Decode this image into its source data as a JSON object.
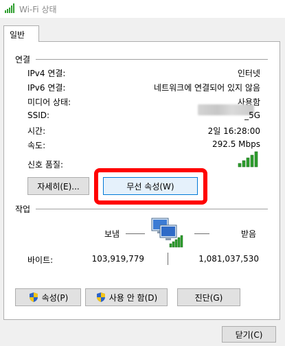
{
  "window": {
    "title": "Wi-Fi 상태"
  },
  "tabs": [
    {
      "label": "일반"
    }
  ],
  "connection": {
    "heading": "연결",
    "rows": [
      {
        "label": "IPv4 연결:",
        "value": "인터넷"
      },
      {
        "label": "IPv6 연결:",
        "value": "네트워크에 연결되어 있지 않음"
      },
      {
        "label": "미디어 상태:",
        "value": "사용함"
      },
      {
        "label": "SSID:",
        "value": "_5G"
      },
      {
        "label": "시간:",
        "value": "2일 16:28:00"
      },
      {
        "label": "속도:",
        "value": "292.5 Mbps"
      }
    ],
    "signal_label": "신호 품질:",
    "signal_bars_filled": 5,
    "signal_bars_total": 5,
    "details_button": "자세히(E)...",
    "wireless_properties_button": "무선 속성(W)"
  },
  "activity": {
    "heading": "작업",
    "sent_label": "보냄",
    "received_label": "받음",
    "bytes_label": "바이트:",
    "bytes_sent": "103,919,779",
    "bytes_received": "1,081,037,530"
  },
  "actions": {
    "properties_button": "속성(P)",
    "disable_button": "사용 안 함(D)",
    "diagnose_button": "진단(G)"
  },
  "footer": {
    "close_button": "닫기(C)"
  },
  "colors": {
    "signal_green": "#2e9e2e",
    "highlight_red": "#ff0000",
    "section_line": "#a0a0a0"
  },
  "icons": {
    "title": "wifi-signal-icon",
    "network": "network-computers-icon",
    "shield": "uac-shield-icon"
  }
}
